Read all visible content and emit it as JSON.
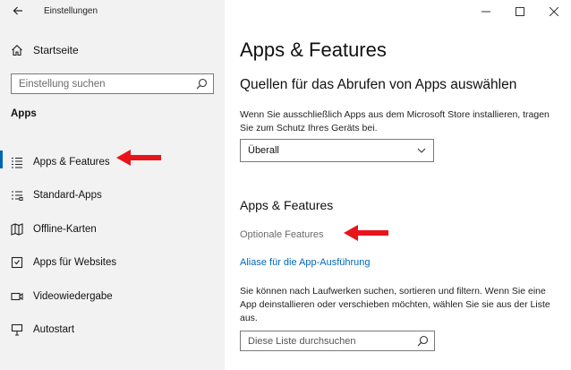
{
  "window": {
    "title": "Einstellungen",
    "back_icon": "back-arrow-icon",
    "controls": {
      "minimize": "—",
      "maximize": "☐",
      "close": "✕"
    }
  },
  "sidebar": {
    "home_label": "Startseite",
    "search_placeholder": "Einstellung suchen",
    "section_label": "Apps",
    "items": [
      {
        "label": "Apps & Features",
        "icon": "list-icon",
        "active": true
      },
      {
        "label": "Standard-Apps",
        "icon": "default-apps-icon",
        "active": false
      },
      {
        "label": "Offline-Karten",
        "icon": "map-icon",
        "active": false
      },
      {
        "label": "Apps für Websites",
        "icon": "websites-icon",
        "active": false
      },
      {
        "label": "Videowiedergabe",
        "icon": "video-icon",
        "active": false
      },
      {
        "label": "Autostart",
        "icon": "startup-icon",
        "active": false
      }
    ]
  },
  "main": {
    "title": "Apps & Features",
    "sources_heading": "Quellen für das Abrufen von Apps auswählen",
    "sources_desc": "Wenn Sie ausschließlich Apps aus dem Microsoft Store installieren, tragen Sie zum Schutz Ihres Geräts bei.",
    "sources_selected": "Überall",
    "apps_heading": "Apps & Features",
    "optional_features": "Optionale Features",
    "alias_link": "Aliase für die App-Ausführung",
    "list_desc": "Sie können nach Laufwerken suchen, sortieren und filtern. Wenn Sie eine App deinstallieren oder verschieben möchten, wählen Sie sie aus der Liste aus.",
    "list_search_placeholder": "Diese Liste durchsuchen"
  },
  "annotation_color": "#e8141b",
  "accent_color": "#0067b8"
}
